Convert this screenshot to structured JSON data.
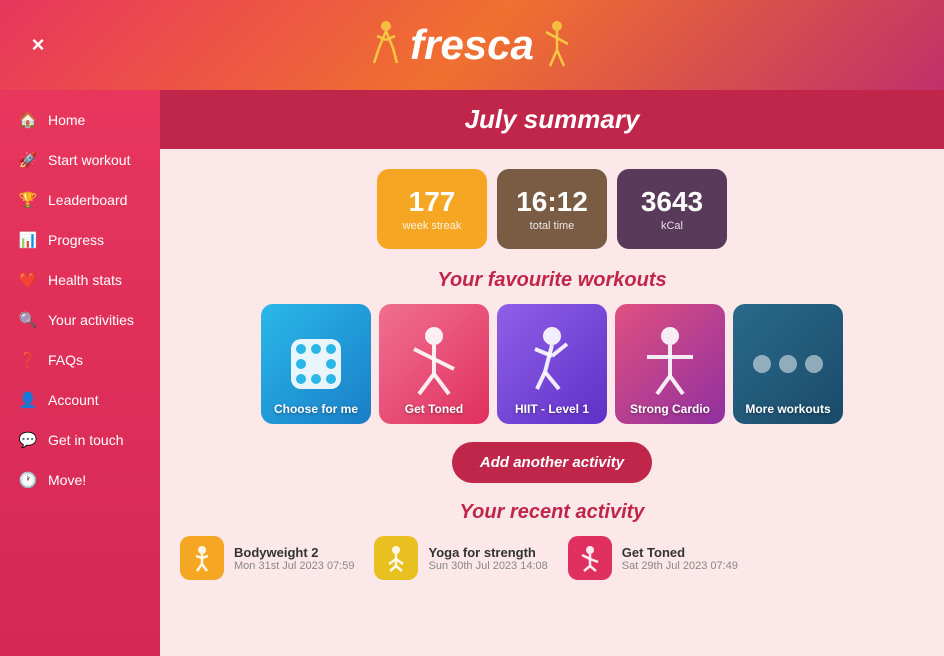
{
  "header": {
    "logo": "fresca",
    "close_label": "×"
  },
  "sidebar": {
    "items": [
      {
        "id": "home",
        "label": "Home",
        "icon": "🏠"
      },
      {
        "id": "start-workout",
        "label": "Start workout",
        "icon": "🚀"
      },
      {
        "id": "leaderboard",
        "label": "Leaderboard",
        "icon": "🏆"
      },
      {
        "id": "progress",
        "label": "Progress",
        "icon": "📊"
      },
      {
        "id": "health-stats",
        "label": "Health stats",
        "icon": "❤️"
      },
      {
        "id": "your-activities",
        "label": "Your activities",
        "icon": "🔍"
      },
      {
        "id": "faqs",
        "label": "FAQs",
        "icon": "❓"
      },
      {
        "id": "account",
        "label": "Account",
        "icon": "👤"
      },
      {
        "id": "get-in-touch",
        "label": "Get in touch",
        "icon": "💬"
      },
      {
        "id": "move",
        "label": "Move!",
        "icon": "🕐"
      }
    ]
  },
  "summary": {
    "title": "July summary",
    "stats": [
      {
        "value": "177",
        "label": "week streak"
      },
      {
        "value": "16:12",
        "label": "total time"
      },
      {
        "value": "3643",
        "label": "kCal"
      }
    ]
  },
  "favourite_workouts": {
    "title": "Your favourite workouts",
    "cards": [
      {
        "id": "choose",
        "label": "Choose for me",
        "type": "dice"
      },
      {
        "id": "get-toned",
        "label": "Get Toned",
        "type": "figure"
      },
      {
        "id": "hiit",
        "label": "HIIT - Level 1",
        "type": "figure"
      },
      {
        "id": "strong-cardio",
        "label": "Strong Cardio",
        "type": "figure"
      },
      {
        "id": "more",
        "label": "More workouts",
        "type": "dots"
      }
    ]
  },
  "add_activity": {
    "label": "Add another activity"
  },
  "recent_activity": {
    "title": "Your recent activity",
    "items": [
      {
        "name": "Bodyweight 2",
        "date": "Mon 31st Jul 2023 07:59",
        "icon_type": "orange"
      },
      {
        "name": "Yoga for strength",
        "date": "Sun 30th Jul 2023 14:08",
        "icon_type": "yellow"
      },
      {
        "name": "Get Toned",
        "date": "Sat 29th Jul 2023 07:49",
        "icon_type": "pink"
      }
    ]
  }
}
